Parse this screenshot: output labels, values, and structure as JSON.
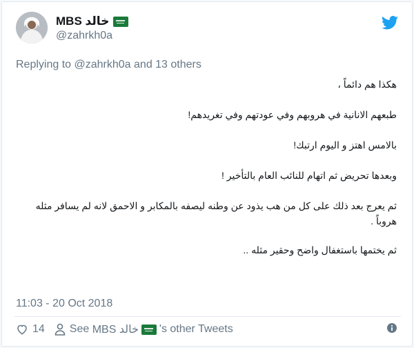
{
  "tweet": {
    "display_name": "MBS خالد",
    "handle": "@zahrkh0a",
    "replying_prefix": "Replying to",
    "replying_mention": "@zahrkh0a",
    "replying_suffix": "and 13 others",
    "lines": [
      "هكذا هم دائماً ،",
      "طبعهم الانانية في هروبهم وفي عودتهم وفي تغريدهم!",
      "بالامس اهتز و اليوم ارتبك!",
      "وبعدها تحريض ثم اتهام للنائب العام بالتأخير !",
      "ثم يعرج بعد ذلك على كل من هب يذود عن وطنه ليصفه بالمكابر و الاحمق لانه لم يسافر مثله هروباً .",
      "ثم يختمها باستغفال واضح وحقير مثله .."
    ],
    "timestamp": "11:03 - 20 Oct 2018",
    "like_count": "14",
    "see_prefix": "See",
    "see_name": "MBS خالد",
    "see_suffix": "'s other Tweets"
  },
  "colors": {
    "twitter_blue": "#1da1f2",
    "secondary_text": "#657786",
    "flag_green": "#1a7a3a"
  },
  "icons": [
    "avatar",
    "saudi-flag-icon",
    "twitter-bird-icon",
    "heart-icon",
    "person-icon",
    "info-icon"
  ]
}
